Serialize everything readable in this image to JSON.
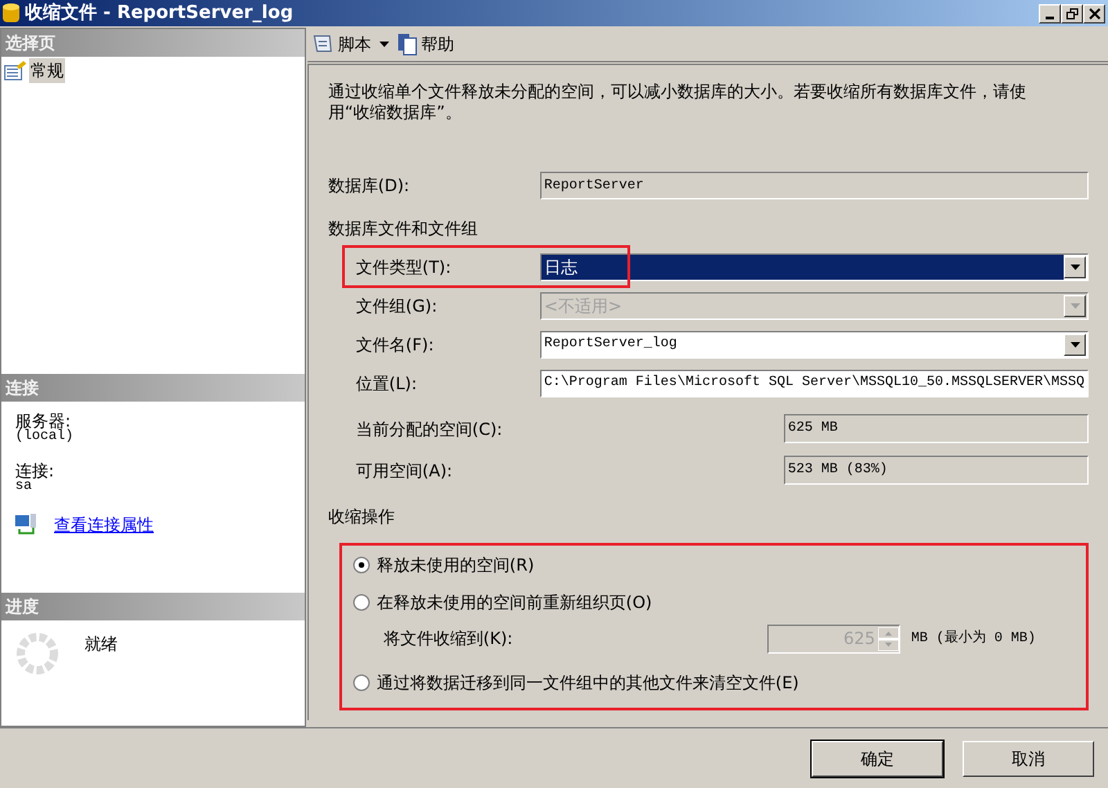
{
  "window": {
    "title": "收缩文件 - ReportServer_log"
  },
  "sidebar": {
    "header": "选择页",
    "pages": [
      {
        "label": "常规",
        "selected": true
      }
    ]
  },
  "connection": {
    "header": "连接",
    "fields": [
      {
        "label": "服务器:",
        "value": "(local)"
      },
      {
        "label": "连接:",
        "value": "sa"
      }
    ],
    "link": "查看连接属性"
  },
  "progress": {
    "header": "进度",
    "status": "就绪"
  },
  "toolbar": [
    {
      "label": "脚本",
      "kind": "dropdown"
    },
    {
      "label": "帮助",
      "kind": "button"
    }
  ],
  "description": "通过收缩单个文件释放未分配的空间，可以减小数据库的大小。若要收缩所有数据库文件，请使用“收缩数据库”。",
  "database": {
    "label": "数据库(D):",
    "value": "ReportServer"
  },
  "files_section": "数据库文件和文件组",
  "file_fields": [
    {
      "label": "文件类型(T):",
      "value": "日志",
      "kind": "combo",
      "disabled": false,
      "focused": true,
      "highlighted": true
    },
    {
      "label": "文件组(G):",
      "value": "<不适用>",
      "kind": "combo",
      "disabled": true,
      "focused": false,
      "highlighted": false
    },
    {
      "label": "文件名(F):",
      "value": "ReportServer_log",
      "kind": "combo",
      "disabled": false,
      "focused": false,
      "highlighted": false
    },
    {
      "label": "位置(L):",
      "value": "C:\\Program Files\\Microsoft SQL Server\\MSSQL10_50.MSSQLSERVER\\MSSQ",
      "kind": "text",
      "disabled": false,
      "focused": false,
      "highlighted": false
    }
  ],
  "space": [
    {
      "label": "当前分配的空间(C):",
      "value": "625 MB"
    },
    {
      "label": "可用空间(A):",
      "value": "523 MB (83%)"
    }
  ],
  "shrink": {
    "title": "收缩操作",
    "highlighted": true,
    "options": [
      {
        "label": "释放未使用的空间(R)",
        "selected": true
      },
      {
        "label": "在释放未使用的空间前重新组织页(O)",
        "selected": false
      },
      {
        "label": "通过将数据迁移到同一文件组中的其他文件来清空文件(E)",
        "selected": false
      }
    ],
    "shrink_to": {
      "label": "将文件收缩到(K):",
      "value": "625",
      "unit": "MB (最小为 0 MB)",
      "disabled": true
    }
  },
  "buttons": [
    "确定",
    "取消"
  ]
}
